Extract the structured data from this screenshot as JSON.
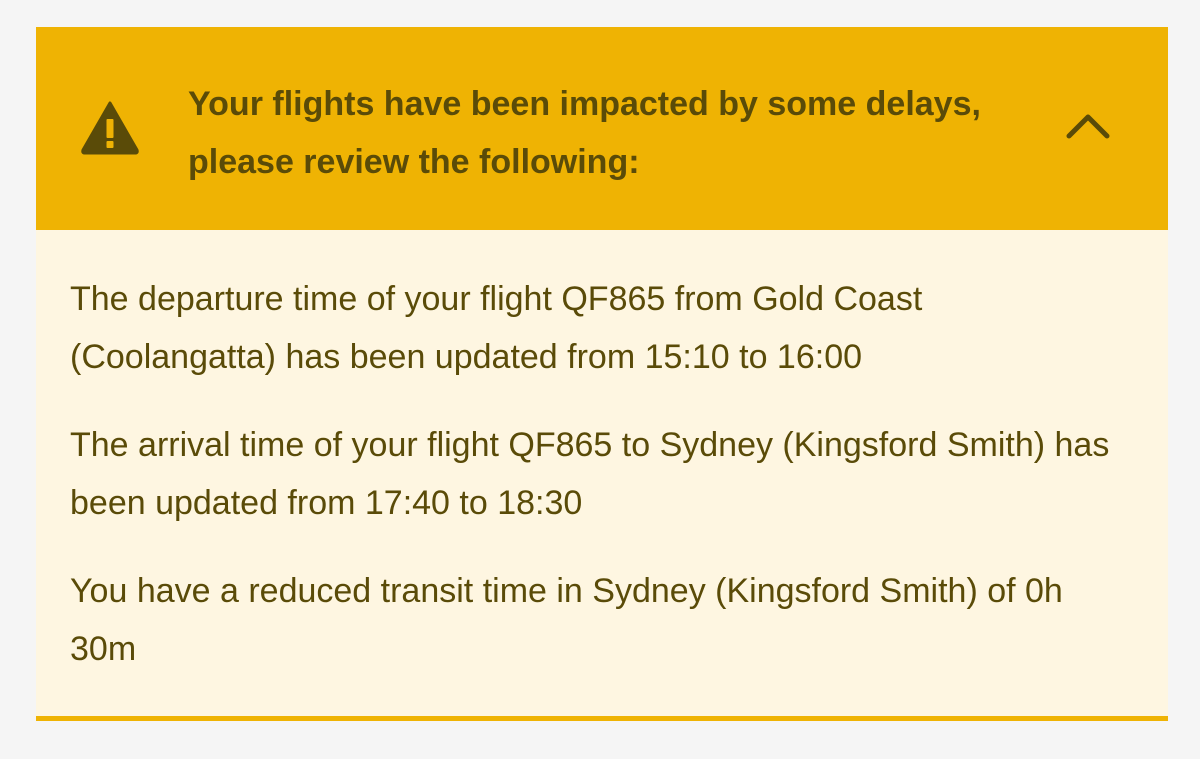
{
  "alert": {
    "heading": "Your flights have been impacted by some delays, please review the following:",
    "icon": "warning-triangle-icon",
    "toggle_icon": "chevron-up-icon",
    "colors": {
      "header_background": "#efb303",
      "body_background": "#fef6e1",
      "text": "#5a4b08",
      "page_background": "#f5f5f5"
    },
    "messages": [
      "The departure time of your flight QF865 from Gold Coast (Coolangatta) has been updated from 15:10 to 16:00",
      "The arrival time of your flight QF865 to Sydney (Kingsford Smith) has been updated from 17:40 to 18:30",
      "You have a reduced transit time in Sydney (Kingsford Smith) of 0h 30m"
    ]
  }
}
